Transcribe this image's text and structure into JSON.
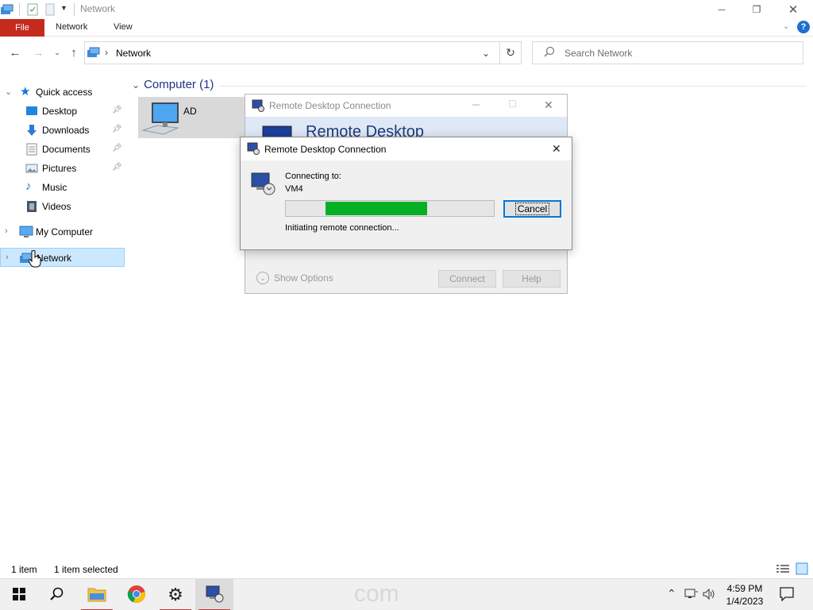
{
  "window": {
    "title": "Network",
    "controls": {
      "minimize_icon": "minimize-icon",
      "maximize_icon": "restore-icon",
      "close_icon": "close-icon"
    }
  },
  "ribbon": {
    "tabs": [
      {
        "label": "File"
      },
      {
        "label": "Network"
      },
      {
        "label": "View"
      }
    ],
    "help_label": "?"
  },
  "address_bar": {
    "path": "Network",
    "search_placeholder": "Search Network"
  },
  "nav_pane": {
    "quick_access": "Quick access",
    "items": [
      {
        "label": "Desktop",
        "icon": "desktop-icon"
      },
      {
        "label": "Downloads",
        "icon": "downloads-icon"
      },
      {
        "label": "Documents",
        "icon": "documents-icon"
      },
      {
        "label": "Pictures",
        "icon": "pictures-icon"
      },
      {
        "label": "Music",
        "icon": "music-icon"
      },
      {
        "label": "Videos",
        "icon": "videos-icon"
      }
    ],
    "my_computer": "My Computer",
    "network": "Network"
  },
  "content": {
    "group_header": "Computer (1)",
    "items": [
      {
        "name": "AD"
      }
    ]
  },
  "status_bar": {
    "item_count": "1 item",
    "selection": "1 item selected"
  },
  "rdc_window": {
    "title": "Remote Desktop Connection",
    "banner": "Remote Desktop",
    "show_options": "Show Options",
    "connect_label": "Connect",
    "help_label": "Help"
  },
  "connecting_dialog": {
    "title": "Remote Desktop Connection",
    "connecting_label": "Connecting to:",
    "host": "VM4",
    "progress_start": 0.19,
    "progress_end": 0.68,
    "cancel_label": "Cancel",
    "status": "Initiating remote connection..."
  },
  "taskbar": {
    "watermark": "com",
    "time": "4:59 PM",
    "date": "1/4/2023"
  },
  "colors": {
    "file_tab": "#c42b1c",
    "selection": "#cce8ff",
    "progress": "#06b025",
    "accent": "#0078d7"
  }
}
